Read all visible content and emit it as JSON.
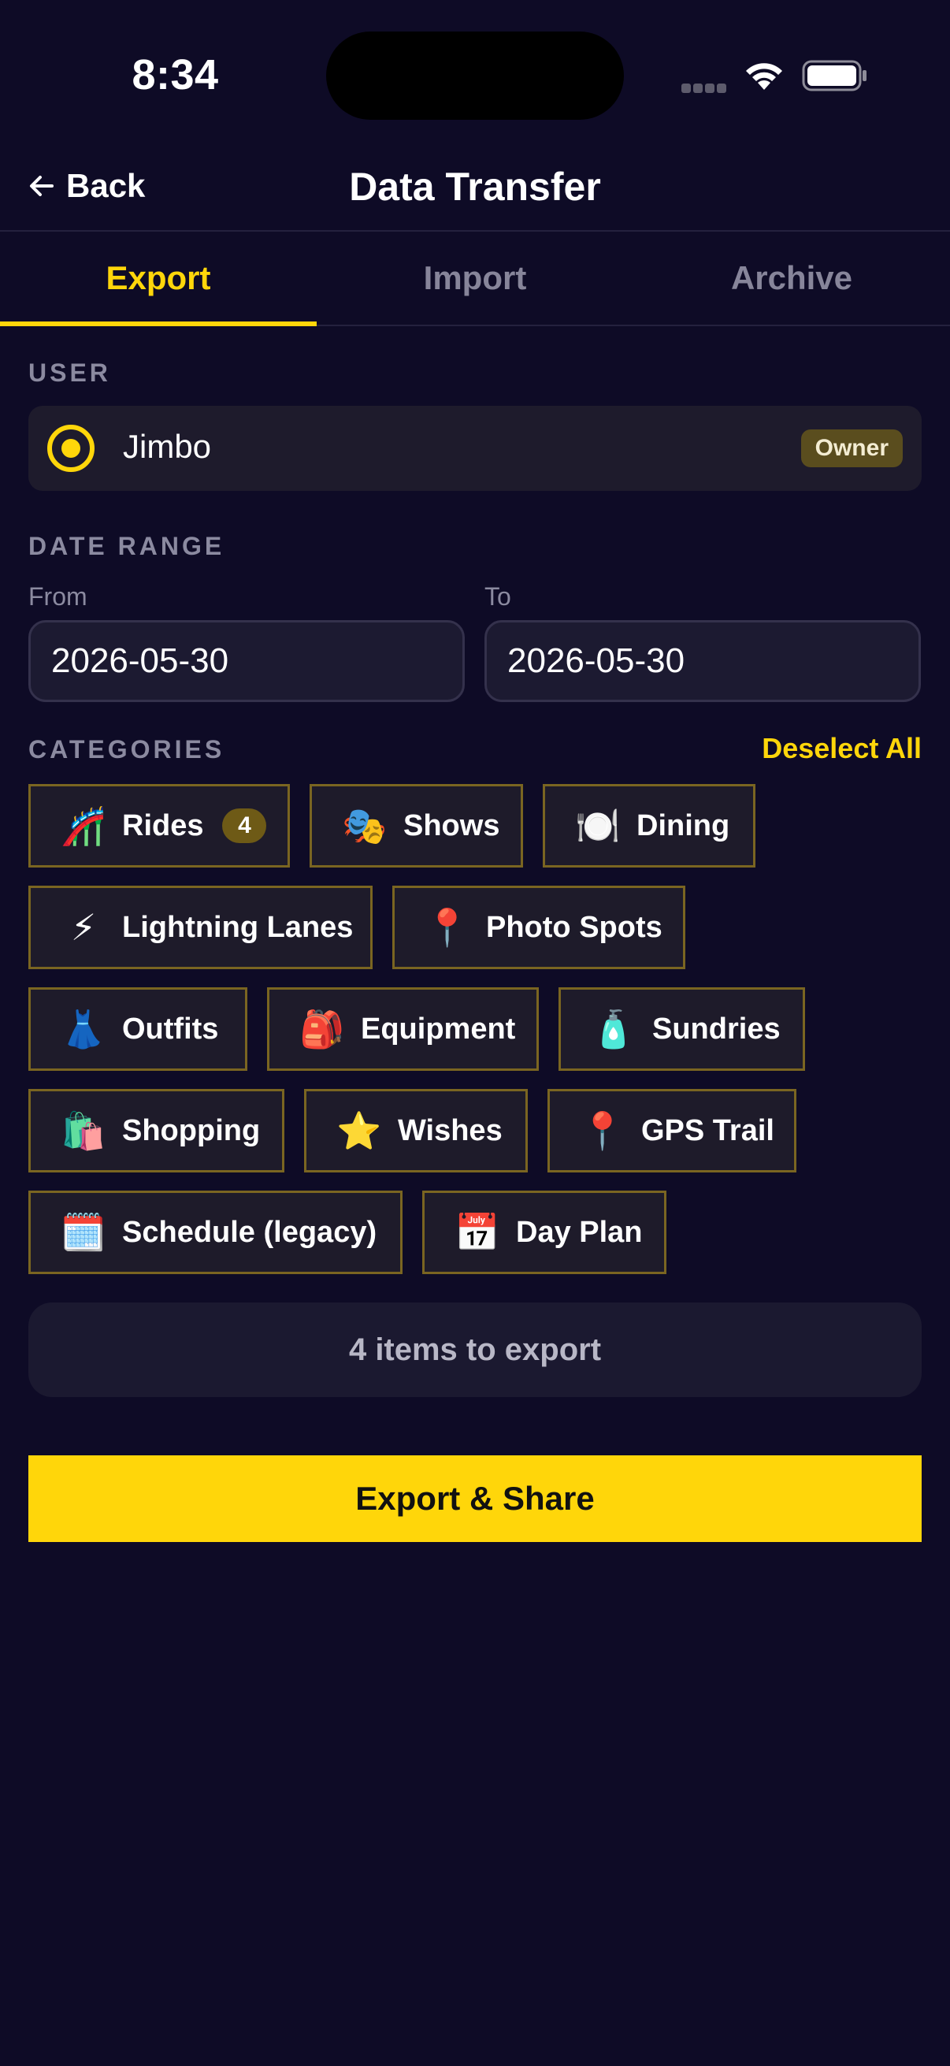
{
  "status_bar": {
    "time": "8:34"
  },
  "header": {
    "back_label": "Back",
    "title": "Data Transfer"
  },
  "tabs": [
    {
      "label": "Export",
      "active": true
    },
    {
      "label": "Import",
      "active": false
    },
    {
      "label": "Archive",
      "active": false
    }
  ],
  "user_section": {
    "label": "USER",
    "user": {
      "name": "Jimbo",
      "badge": "Owner",
      "selected": true
    }
  },
  "date_range": {
    "label": "DATE RANGE",
    "from_label": "From",
    "from_value": "2026-05-30",
    "to_label": "To",
    "to_value": "2026-05-30"
  },
  "categories": {
    "label": "CATEGORIES",
    "deselect_label": "Deselect All",
    "items": [
      {
        "icon": "roller-coaster-icon",
        "emoji": "🎢",
        "label": "Rides",
        "count": "4"
      },
      {
        "icon": "theater-masks-icon",
        "emoji": "🎭",
        "label": "Shows"
      },
      {
        "icon": "plate-cutlery-icon",
        "emoji": "🍽️",
        "label": "Dining"
      },
      {
        "icon": "lightning-icon",
        "emoji": "⚡",
        "label": "Lightning Lanes"
      },
      {
        "icon": "pin-icon",
        "emoji": "📍",
        "label": "Photo Spots"
      },
      {
        "icon": "dress-icon",
        "emoji": "👗",
        "label": "Outfits"
      },
      {
        "icon": "backpack-icon",
        "emoji": "🎒",
        "label": "Equipment"
      },
      {
        "icon": "lotion-bottle-icon",
        "emoji": "🧴",
        "label": "Sundries"
      },
      {
        "icon": "shopping-bags-icon",
        "emoji": "🛍️",
        "label": "Shopping"
      },
      {
        "icon": "star-icon",
        "emoji": "⭐",
        "label": "Wishes"
      },
      {
        "icon": "pin-icon",
        "emoji": "📍",
        "label": "GPS Trail"
      },
      {
        "icon": "spiral-calendar-icon",
        "emoji": "🗓️",
        "label": "Schedule (legacy)"
      },
      {
        "icon": "calendar-icon",
        "emoji": "📅",
        "label": "Day Plan"
      }
    ]
  },
  "summary": {
    "text": "4 items to export"
  },
  "actions": {
    "export_label": "Export & Share"
  },
  "colors": {
    "background": "#0e0b26",
    "accent": "#ffd60a",
    "chip_border": "#7a6521",
    "muted_text": "#8b8aa0"
  }
}
